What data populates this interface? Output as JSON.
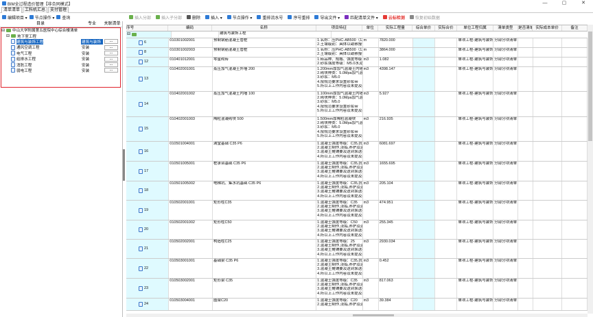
{
  "window": {
    "title": "BIM全过程造价管理【非合同模式】",
    "controls": [
      "—",
      "▢",
      "✕"
    ]
  },
  "tabs": [
    "清单清单",
    "工料机汇总",
    "支付管理"
  ],
  "left_toolbar": [
    {
      "icon": "edit-icon",
      "label": "编辑项目 ▾",
      "color": "#2e7bd6"
    },
    {
      "icon": "node-icon",
      "label": "节点操作 ▾",
      "color": "#2e7bd6"
    },
    {
      "icon": "search-icon",
      "label": "查询",
      "color": "#2e7bd6"
    }
  ],
  "tree": {
    "headers": [
      "目录",
      "专业",
      "关联清单"
    ],
    "rows": [
      {
        "indent": 0,
        "label": "中山大学附属第五医院中心综合楼清单",
        "spec": "",
        "btn": ""
      },
      {
        "indent": 1,
        "label": "地下室工程",
        "spec": "",
        "btn": ""
      },
      {
        "indent": 2,
        "label": "建筑与装饰工程",
        "spec": "建筑与装饰",
        "btn": "...",
        "sel": true
      },
      {
        "indent": 2,
        "label": "通风空调工程",
        "spec": "安装",
        "btn": "..."
      },
      {
        "indent": 2,
        "label": "电气工程",
        "spec": "安装",
        "btn": "..."
      },
      {
        "indent": 2,
        "label": "给排水工程",
        "spec": "安装",
        "btn": "..."
      },
      {
        "indent": 2,
        "label": "消防工程",
        "spec": "安装",
        "btn": "..."
      },
      {
        "indent": 2,
        "label": "弱电工程",
        "spec": "安装",
        "btn": "..."
      }
    ]
  },
  "right_toolbar": [
    {
      "icon": "insert-group-icon",
      "label": "插入分部",
      "color": "#6ab04c",
      "disabled": true
    },
    {
      "icon": "insert-subgroup-icon",
      "label": "插入子分部",
      "color": "#6ab04c",
      "disabled": true
    },
    {
      "icon": "delete-icon",
      "label": "删除",
      "color": "#555"
    },
    {
      "icon": "insert-icon",
      "label": "插入 ▾",
      "color": "#2e7bd6"
    },
    {
      "icon": "node-icon",
      "label": "节点操作 ▾",
      "color": "#2e7bd6"
    },
    {
      "icon": "renumber-icon",
      "label": "重排流水号",
      "color": "#2e7bd6"
    },
    {
      "icon": "sort-icon",
      "label": "序号重排",
      "color": "#2e7bd6"
    },
    {
      "icon": "import-file-icon",
      "label": "导出文件 ▾",
      "color": "#2e7bd6"
    },
    {
      "icon": "match-icon",
      "label": "匹配清单文件 ▾",
      "color": "#7b2fbf"
    },
    {
      "icon": "cloud-icon",
      "label": "云标检测",
      "color": "#e53935",
      "strong": true
    },
    {
      "icon": "restore-icon",
      "label": "恢复初始数据",
      "color": "#888",
      "disabled": true
    }
  ],
  "grid": {
    "headers": [
      "序号",
      "编码",
      "名称",
      "项目特征",
      "单位",
      "实际工程量",
      "综合单价",
      "实际合价",
      "单位工程归属",
      "清单类型",
      "是否清单",
      "实际成本单价",
      "备注"
    ],
    "group_name": "建筑与装饰工程",
    "rows": [
      {
        "seq": "6",
        "code": "010301002001",
        "name": "预制钢筋混凝土管桩",
        "feat": [
          "1.名称：压PHC-AB500（125",
          "2.土壤级别：具体以勘察报告"
        ],
        "unit": "m",
        "qty": "7820.000",
        "cat": "单项工程-建筑与装饰",
        "type": "分部分项清单",
        "h": 14
      },
      {
        "seq": "8",
        "code": "010301002003",
        "name": "预制钢筋混凝土管桩",
        "feat": [
          "1.名称：压PHC-AB500（125",
          "2.土壤级别：具体以勘察报告"
        ],
        "unit": "m",
        "qty": "3864.000",
        "cat": "单项工程-建筑与装饰",
        "type": "分部分项清单",
        "h": 14
      },
      {
        "seq": "12",
        "code": "010401012001",
        "name": "零星砌砖",
        "feat": [
          "1.砖品种、规格、强度等级：",
          "2.砂浆强度等级：M5.0水泥石"
        ],
        "unit": "m3",
        "qty": "1.082",
        "cat": "单项工程-建筑与装饰",
        "type": "分部分项清单",
        "h": 14
      },
      {
        "seq": "13",
        "code": "010402001001",
        "name": "蒸压加气混凝土外墙 200",
        "feat": [
          "1.200mm厚加气混凝土内墙",
          "2.砌块种类：5.0Mpa加气混",
          "3.砂浆：M5.0",
          "4.按规范要求设置砂浆带",
          "5.所以上工作内容及未提及部"
        ],
        "unit": "m3",
        "qty": "4398.147",
        "cat": "单项工程-建筑与装饰",
        "type": "分部分项清单",
        "h": 36
      },
      {
        "seq": "14",
        "code": "010402001002",
        "name": "蒸压加气混凝土内墙 100",
        "feat": [
          "1.100mm厚加气混凝土内墙",
          "2.砌块种类：5.0Mpa加气混",
          "3.砂浆：M5.0",
          "4.按规范要求设置砂浆带",
          "5.所以上工作内容及未提及部"
        ],
        "unit": "m3",
        "qty": "5.927",
        "cat": "单项工程-建筑与装饰",
        "type": "分部分项清单",
        "h": 37
      },
      {
        "seq": "15",
        "code": "010402001003",
        "name": "陶粒混凝砌块 500",
        "feat": [
          "1.500mm厚陶粒混凝块",
          "2.砌块种类：5.0Mpa加气混",
          "3.砂浆：M5.0",
          "4.按规范要求设置砂浆带",
          "5.所以上工作内容及未提及部"
        ],
        "unit": "m3",
        "qty": "216.935",
        "cat": "单项工程-建筑与装饰",
        "type": "分部分项清单",
        "h": 36
      },
      {
        "seq": "16",
        "code": "010501004001",
        "name": "满堂基础 C35 P6",
        "feat": [
          "1.混凝土强度等级：C35,抗渗",
          "2.混凝土制作,浇捣,养护及运",
          "3.混凝土摊铺要及送到泵送机",
          "4.所以上工作内容及未提及部"
        ],
        "unit": "m3",
        "qty": "6081.697",
        "cat": "单项工程-建筑与装饰",
        "type": "分部分项清单",
        "h": 29
      },
      {
        "seq": "17",
        "code": "010501005001",
        "name": "桩承台基础 C35 P6",
        "feat": [
          "1.混凝土强度等级：C35,抗渗",
          "2.混凝土制作,浇捣,养护及运",
          "3.混凝土摊铺要及送到泵送机",
          "4.所以上工作内容及未提及部"
        ],
        "unit": "m3",
        "qty": "1655.695",
        "cat": "单项工程-建筑与装饰",
        "type": "分部分项清单",
        "h": 29
      },
      {
        "seq": "18",
        "code": "010501005002",
        "name": "电梯坑、集水坑基础 C35 P6",
        "feat": [
          "1.混凝土强度等级：C35,抗渗",
          "2.混凝土制作,浇捣,养护及运",
          "3.混凝土摊铺要及送到泵送机",
          "4.所以上工作内容及未提及部"
        ],
        "unit": "m3",
        "qty": "205.104",
        "cat": "单项工程-建筑与装饰",
        "type": "分部分项清单",
        "h": 28
      },
      {
        "seq": "19",
        "code": "010502001001",
        "name": "矩形柱C35",
        "feat": [
          "1.混凝土强度等级：C35",
          "2.混凝土制作,浇捣,养护及运",
          "3.混凝土摊铺要及送到泵送机",
          "4.所以上工作内容及未提及部"
        ],
        "unit": "m3",
        "qty": "474.951",
        "cat": "单项工程-建筑与装饰",
        "type": "分部分项清单",
        "h": 29
      },
      {
        "seq": "20",
        "code": "010502001002",
        "name": "矩形柱C50",
        "feat": [
          "1.混凝土强度等级：C50",
          "2.混凝土制作,浇捣,养护及运",
          "3.混凝土摊铺要及送到泵送机",
          "4.所以上工作内容及未提及部"
        ],
        "unit": "m3",
        "qty": "255.345",
        "cat": "单项工程-建筑与装饰",
        "type": "分部分项清单",
        "h": 28
      },
      {
        "seq": "21",
        "code": "010502002001",
        "name": "构造柱C25",
        "feat": [
          "1.混凝土强度等级：25",
          "2.混凝土制作,浇捣,养护及运",
          "3.混凝土摊铺要及送到泵送机",
          "4.所以上工作内容及未提及部"
        ],
        "unit": "m3",
        "qty": "2930.034",
        "cat": "单项工程-建筑与装饰",
        "type": "分部分项清单",
        "h": 28
      },
      {
        "seq": "22",
        "code": "010503001001",
        "name": "基础梁 C35 P6",
        "feat": [
          "1.混凝土强度等级：C35,抗渗",
          "2.混凝土制作,浇捣,养护及运",
          "3.混凝土摊铺要及送到泵送机",
          "4.所以上工作内容及未提及部"
        ],
        "unit": "m3",
        "qty": "0.452",
        "cat": "单项工程-建筑与装饰",
        "type": "分部分项清单",
        "h": 29
      },
      {
        "seq": "23",
        "code": "010503002001",
        "name": "矩形梁 C35",
        "feat": [
          "1.混凝土强度等级：C35",
          "2.混凝土制作,浇捣,养护及运",
          "3.混凝土摊铺要及送到泵送机",
          "4.所以上工作内容及未提及部"
        ],
        "unit": "m3",
        "qty": "817.063",
        "cat": "单项工程-建筑与装饰",
        "type": "分部分项清单",
        "h": 29
      },
      {
        "seq": "24",
        "code": "010503004001",
        "name": "圈梁C20",
        "feat": [
          "1.混凝土强度等级：C20",
          "2.混凝土制作,浇捣,养护及运"
        ],
        "unit": "m3",
        "qty": "39.384",
        "cat": "单项工程-建筑与装饰",
        "type": "分部分项清单",
        "h": 18
      }
    ]
  }
}
